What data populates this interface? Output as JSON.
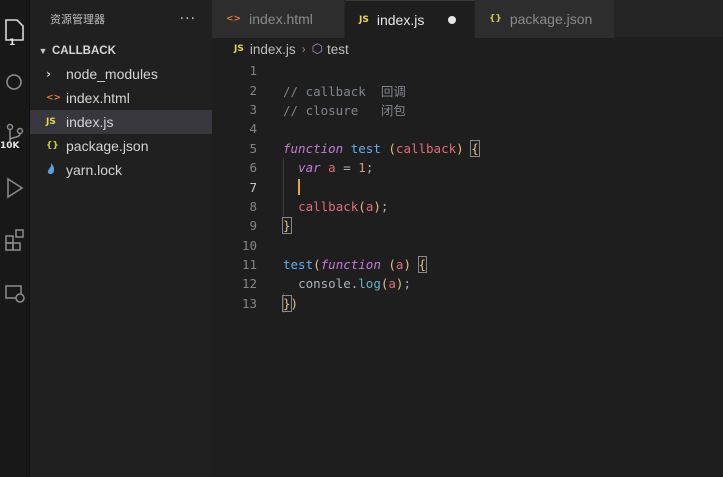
{
  "activity": {
    "explorer_badge": "1",
    "source_control_badge": "10K"
  },
  "sidebar": {
    "title": "资源管理器",
    "more": "···",
    "folder": "CALLBACK",
    "items": [
      {
        "label": "node_modules",
        "icon": "chevron-right-icon"
      },
      {
        "label": "index.html",
        "icon": "html-file-icon",
        "icon_text": "<>"
      },
      {
        "label": "index.js",
        "icon": "js-file-icon",
        "icon_text": "JS",
        "selected": true
      },
      {
        "label": "package.json",
        "icon": "json-file-icon",
        "icon_text": "{}"
      },
      {
        "label": "yarn.lock",
        "icon": "yarn-icon"
      }
    ]
  },
  "tabs": [
    {
      "label": "index.html",
      "icon_text": "<>"
    },
    {
      "label": "index.js",
      "icon_text": "JS",
      "active": true,
      "modified": true
    },
    {
      "label": "package.json",
      "icon_text": "{}"
    }
  ],
  "breadcrumbs": {
    "file": "index.js",
    "file_icon": "JS",
    "symbol": "test"
  },
  "editor": {
    "current_line": 7,
    "lines": [
      {
        "n": "1",
        "text": ""
      },
      {
        "n": "2",
        "text": "// callback  回调"
      },
      {
        "n": "3",
        "text": "// closure   闭包"
      },
      {
        "n": "4",
        "text": ""
      },
      {
        "n": "5",
        "text": "function test (callback) {"
      },
      {
        "n": "6",
        "text": "  var a = 1;"
      },
      {
        "n": "7",
        "text": ""
      },
      {
        "n": "8",
        "text": "  callback(a);"
      },
      {
        "n": "9",
        "text": "}"
      },
      {
        "n": "10",
        "text": ""
      },
      {
        "n": "11",
        "text": "test(function (a) {"
      },
      {
        "n": "12",
        "text": "  console.log(a);"
      },
      {
        "n": "13",
        "text": "})"
      }
    ]
  },
  "colors": {
    "background": "#1e1e1e",
    "sidebar": "#202021",
    "cursor": "#e8a33d",
    "keyword": "#c678dd",
    "function": "#61afef",
    "comment": "#7f848e"
  }
}
